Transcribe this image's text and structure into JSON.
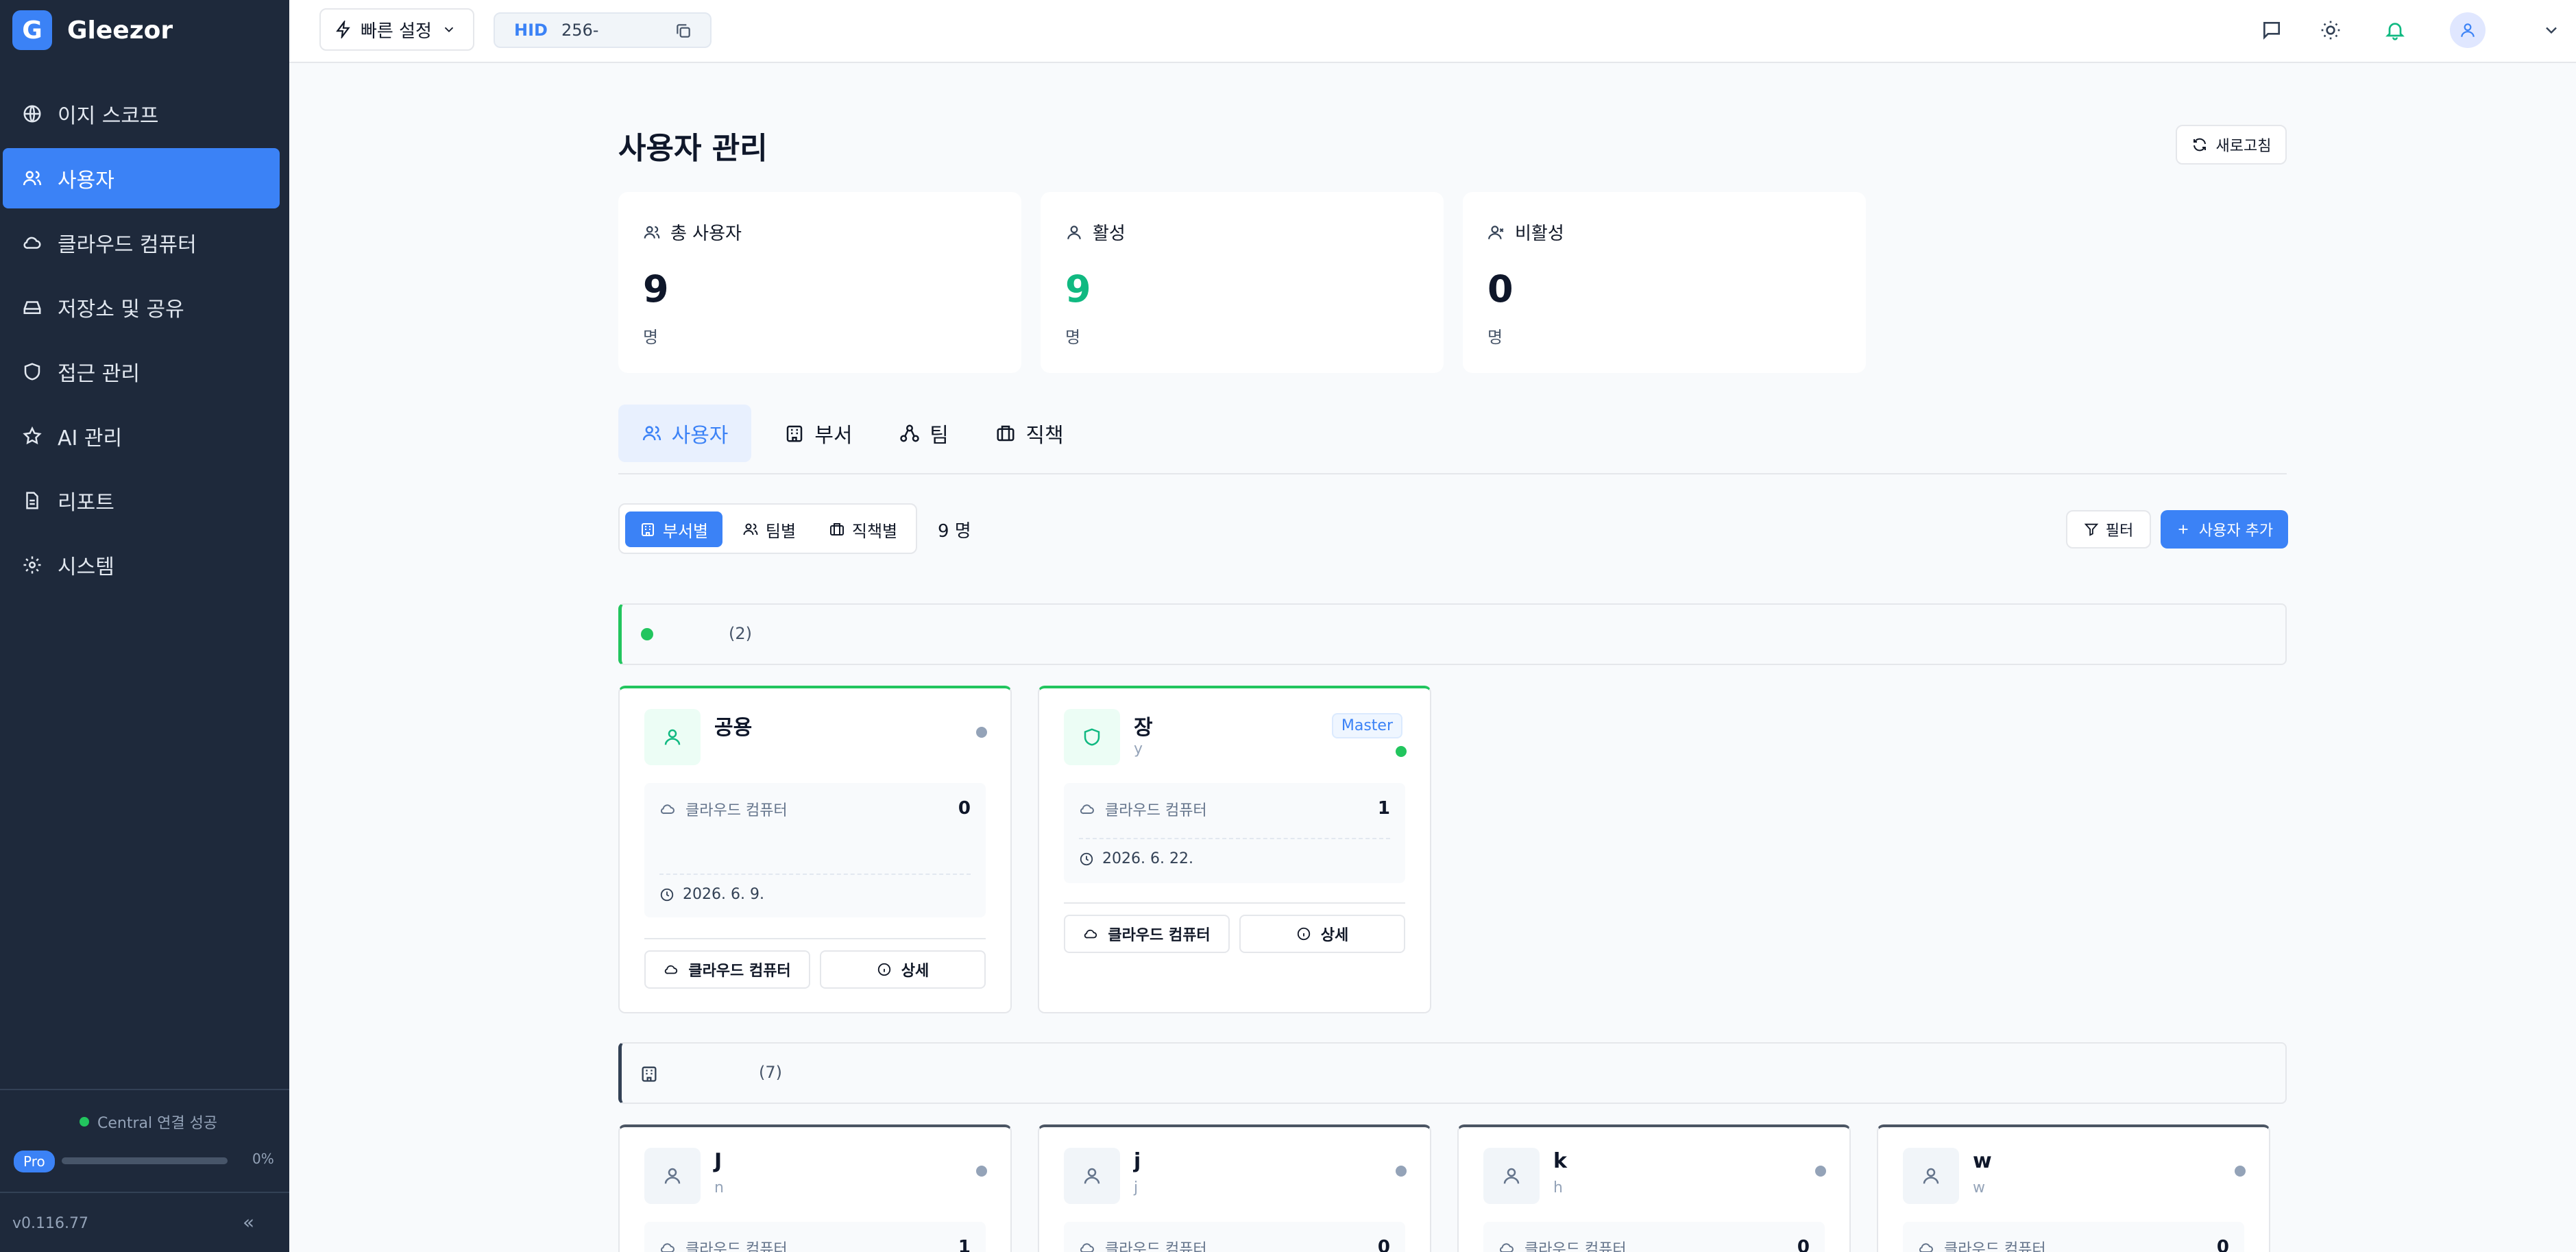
{
  "app": {
    "logo_letter": "G",
    "name": "Gleezor"
  },
  "sidebar": {
    "items": [
      {
        "label": "이지 스코프",
        "icon": "globe-icon"
      },
      {
        "label": "사용자",
        "icon": "users-icon",
        "active": true
      },
      {
        "label": "클라우드 컴퓨터",
        "icon": "cloud-icon"
      },
      {
        "label": "저장소 및 공유",
        "icon": "storage-icon"
      },
      {
        "label": "접근 관리",
        "icon": "shield-icon"
      },
      {
        "label": "AI 관리",
        "icon": "star-icon"
      },
      {
        "label": "리포트",
        "icon": "file-icon"
      },
      {
        "label": "시스템",
        "icon": "gear-icon"
      }
    ],
    "connection_status": "Central 연결 성공",
    "plan_badge": "Pro",
    "usage_percent": 0,
    "usage_label": "0%",
    "version": "v0.116.77",
    "collapse_glyph": "«"
  },
  "topbar": {
    "quick_settings_label": "빠른 설정",
    "hid_label": "HID",
    "hid_value": "256-"
  },
  "page": {
    "title": "사용자 관리",
    "refresh_label": "새로고침"
  },
  "stats": [
    {
      "label": "총 사용자",
      "value": "9",
      "unit": "명"
    },
    {
      "label": "활성",
      "value": "9",
      "unit": "명"
    },
    {
      "label": "비활성",
      "value": "0",
      "unit": "명"
    }
  ],
  "tabs": [
    {
      "label": "사용자",
      "active": true
    },
    {
      "label": "부서"
    },
    {
      "label": "팀"
    },
    {
      "label": "직책"
    }
  ],
  "view_modes": [
    {
      "label": "부서별",
      "active": true
    },
    {
      "label": "팀별"
    },
    {
      "label": "직책별"
    }
  ],
  "user_count_label": "9 명",
  "filter_label": "필터",
  "add_user_label": "사용자 추가",
  "groups": [
    {
      "count_label": "(2)",
      "cards": [
        {
          "name": "공용",
          "sub": "",
          "resource_label": "클라우드 컴퓨터",
          "resource_count": "0",
          "date": "2026. 6. 9.",
          "btn_cloud": "클라우드 컴퓨터",
          "btn_detail": "상세"
        },
        {
          "name": "장",
          "sub": "y",
          "badge": "Master",
          "resource_label": "클라우드 컴퓨터",
          "resource_count": "1",
          "date": "2026. 6. 22.",
          "btn_cloud": "클라우드 컴퓨터",
          "btn_detail": "상세"
        }
      ]
    },
    {
      "count_label": "(7)",
      "cards": [
        {
          "name": "J",
          "sub": "n",
          "resource_label": "클라우드 컴퓨터",
          "resource_count": "1"
        },
        {
          "name": "j",
          "sub": "j",
          "resource_label": "클라우드 컴퓨터",
          "resource_count": "0"
        },
        {
          "name": "k",
          "sub": "h",
          "resource_label": "클라우드 컴퓨터",
          "resource_count": "0"
        },
        {
          "name": "w",
          "sub": "w",
          "resource_label": "클라우드 컴퓨터",
          "resource_count": "0"
        }
      ]
    }
  ],
  "colors": {
    "accent": "#3b82f6",
    "sidebar_bg": "#1e293b",
    "active_green": "#10b981"
  }
}
